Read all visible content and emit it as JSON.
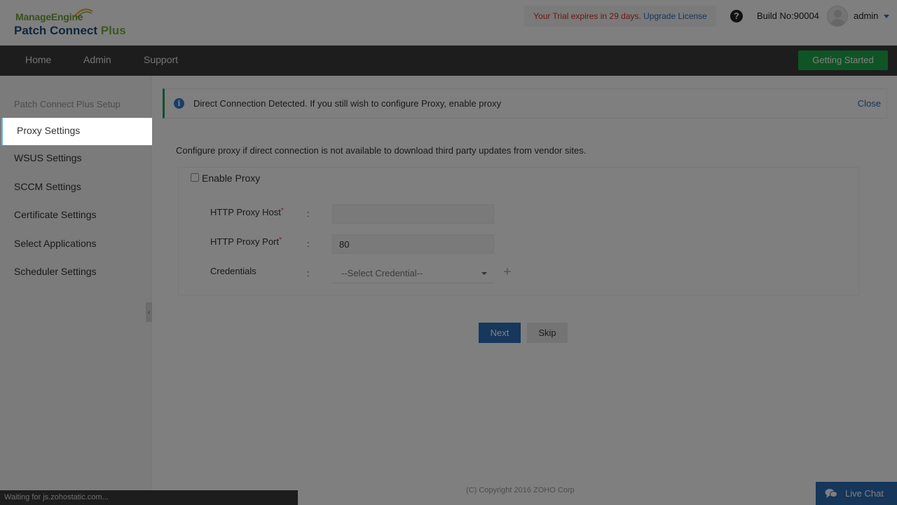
{
  "header": {
    "logo_brand": "ManageEngine",
    "logo_product_main": "Patch Connect",
    "logo_product_plus": "Plus",
    "trial_text": "Your Trial expires in 29 days.",
    "upgrade_label": "Upgrade License",
    "help_icon": "question-circle-icon",
    "build_label": "Build No:90004",
    "user_name": "admin"
  },
  "nav": {
    "items": [
      "Home",
      "Admin",
      "Support"
    ],
    "getting_started_label": "Getting Started"
  },
  "sidebar": {
    "title": "Patch Connect Plus Setup",
    "items": [
      {
        "label": "Proxy Settings",
        "active": true
      },
      {
        "label": "WSUS Settings"
      },
      {
        "label": "SCCM Settings"
      },
      {
        "label": "Certificate Settings"
      },
      {
        "label": "Select Applications"
      },
      {
        "label": "Scheduler Settings"
      }
    ],
    "collapse_glyph": "‹"
  },
  "banner": {
    "text": "Direct Connection Detected. If you still wish to configure Proxy, enable proxy",
    "close_label": "Close"
  },
  "form": {
    "description": "Configure proxy if direct connection is not available to download third party updates from vendor sites.",
    "enable_proxy_label": "Enable Proxy",
    "enable_proxy_checked": false,
    "host_label": "HTTP Proxy Host",
    "host_value": "",
    "port_label": "HTTP Proxy Port",
    "port_value": "80",
    "credentials_label": "Credentials",
    "credentials_selected": "--Select Credential--",
    "colon": ":",
    "required_mark": "*",
    "add_glyph": "+"
  },
  "actions": {
    "next_label": "Next",
    "skip_label": "Skip"
  },
  "footer": {
    "copyright": "(C) Copyright 2016 ZOHO Corp",
    "status_text": "Waiting for js.zohostatic.com...",
    "live_chat_label": "Live Chat"
  },
  "colors": {
    "accent_green": "#1fa84a",
    "primary_blue": "#2f6fb8",
    "nav_dark": "#3a3a3a",
    "trial_red": "#d32f2f"
  }
}
